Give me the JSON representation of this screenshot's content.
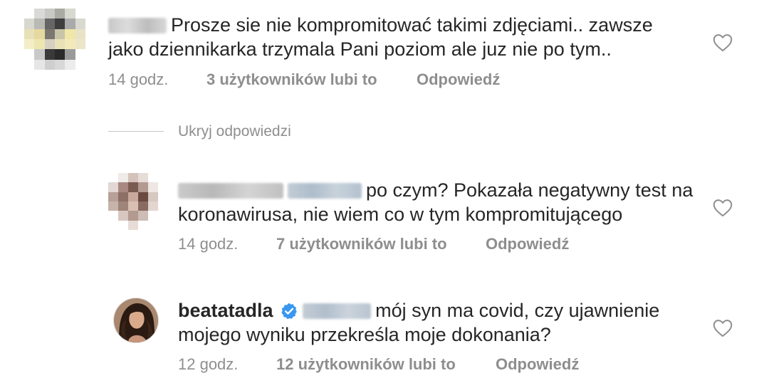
{
  "comments": [
    {
      "text": "Prosze sie nie kompromitować takimi zdjęciami.. zawsze jako dziennikarka trzymala Pani poziom ale juz nie po tym..",
      "time": "14 godz.",
      "likes": "3 użytkowników lubi to",
      "reply": "Odpowiedź"
    }
  ],
  "hide_replies": "Ukryj odpowiedzi",
  "replies": [
    {
      "text": "po czym? Pokazała negatywny test na koronawirusa, nie wiem co w tym kompromitującego",
      "time": "14 godz.",
      "likes": "7 użytkowników lubi to",
      "reply": "Odpowiedź"
    },
    {
      "username": "beatatadla",
      "text": "mój syn ma covid, czy ujawnienie mojego wyniku przekreśla moje dokonania?",
      "time": "12 godz.",
      "likes": "12 użytkowników lubi to",
      "reply": "Odpowiedź"
    }
  ],
  "icons": {
    "like": "heart-outline-icon",
    "verified": "verified-badge-icon"
  },
  "colors": {
    "text": "#262626",
    "muted": "#8e8e8e",
    "verified": "#3897f0"
  }
}
